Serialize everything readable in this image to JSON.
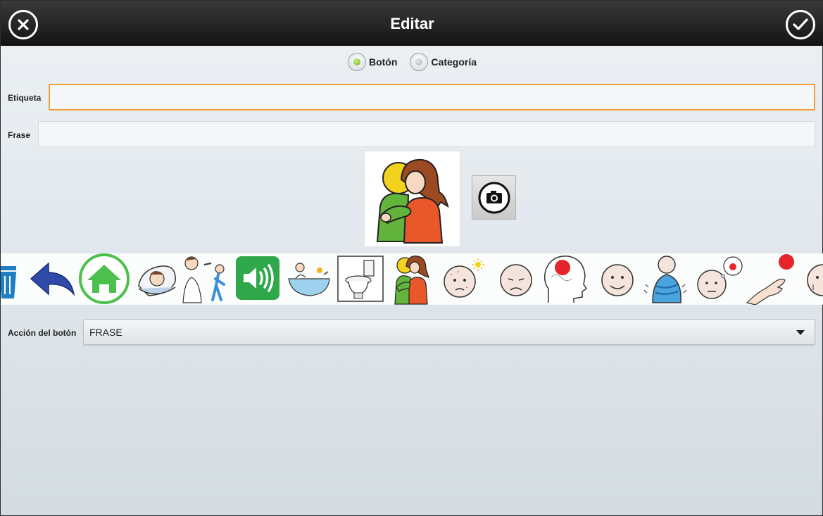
{
  "header": {
    "title": "Editar",
    "close_icon": "close-circle-icon",
    "confirm_icon": "check-circle-icon"
  },
  "type_selector": {
    "options": [
      {
        "label": "Botón",
        "selected": true
      },
      {
        "label": "Categoría",
        "selected": false
      }
    ]
  },
  "form": {
    "label_field": {
      "label": "Etiqueta",
      "value": ""
    },
    "phrase_field": {
      "label": "Frase",
      "value": ""
    },
    "action": {
      "label": "Acción del botón",
      "selected": "FRASE"
    }
  },
  "image": {
    "pictogram": "hug-pictogram",
    "camera_icon": "camera-icon"
  },
  "pictogram_strip": [
    "trash-icon",
    "back-arrow-icon",
    "home-icon",
    "sleep-pictogram",
    "wash-pictogram",
    "speaker-icon",
    "bath-pictogram",
    "toilet-pictogram",
    "hug-pictogram",
    "hot-face-pictogram",
    "sad-face-pictogram",
    "headache-pictogram",
    "happy-face-pictogram",
    "cold-pictogram",
    "hungry-face-pictogram",
    "hand-point-pictogram",
    "face-pictogram"
  ],
  "colors": {
    "focus": "#f0a038",
    "radio_on": "#6ab42a",
    "home_green": "#4cc04c",
    "speaker_green": "#2fa84a",
    "arrow_blue": "#2f4aa8"
  }
}
